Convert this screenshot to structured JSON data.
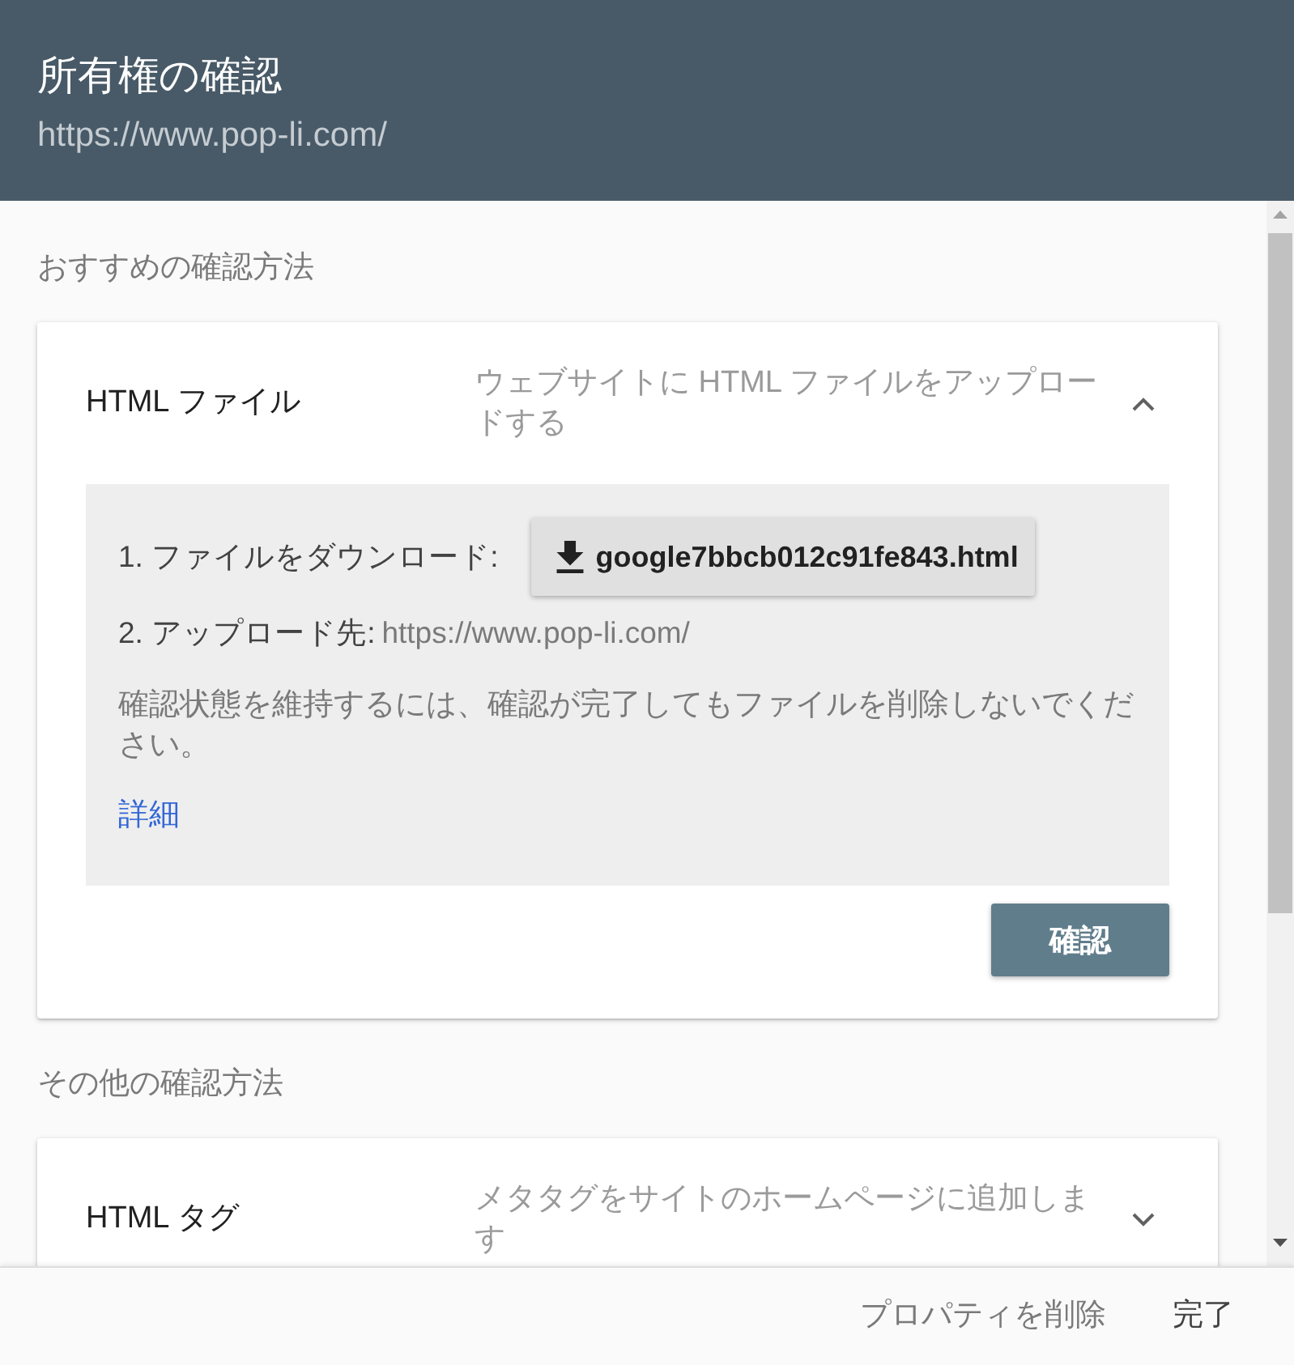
{
  "dialog": {
    "title": "所有権の確認",
    "url": "https://www.pop-li.com/"
  },
  "sections": [
    {
      "heading": "おすすめの確認方法",
      "methods": [
        {
          "name": "HTML ファイル",
          "description": "ウェブサイトに HTML ファイルをアップロードする",
          "expanded": true,
          "steps": [
            {
              "kind": "download",
              "label": "1. ファイルをダウンロード:",
              "file": "google7bbcb012c91fe843.html"
            },
            {
              "kind": "destination",
              "label": "2. アップロード先:",
              "value": "https://www.pop-li.com/"
            }
          ],
          "note": "確認状態を維持するには、確認が完了してもファイルを削除しないでください。",
          "link": "詳細",
          "action": "確認"
        }
      ]
    },
    {
      "heading": "その他の確認方法",
      "methods": [
        {
          "name": "HTML タグ",
          "description": "メタタグをサイトのホームページに追加します",
          "expanded": false
        }
      ]
    }
  ],
  "footer": {
    "buttons": [
      {
        "label": "プロパティを削除",
        "kind": "secondary"
      },
      {
        "label": "完了",
        "kind": "primary"
      }
    ]
  }
}
